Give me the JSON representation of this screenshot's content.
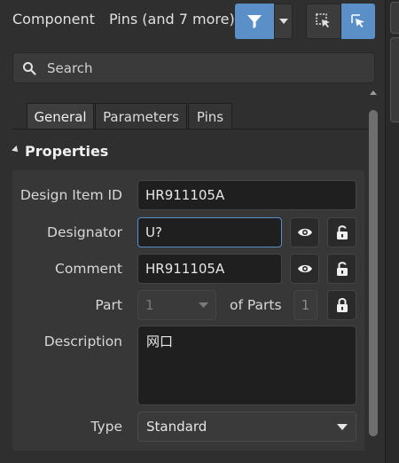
{
  "header": {
    "kind_label": "Component",
    "filter_text": "Pins (and 7 more)"
  },
  "search": {
    "placeholder": "Search"
  },
  "tabs": [
    {
      "label": "General",
      "active": true
    },
    {
      "label": "Parameters",
      "active": false
    },
    {
      "label": "Pins",
      "active": false
    }
  ],
  "section": {
    "title": "Properties"
  },
  "properties": {
    "design_item_id": {
      "label": "Design Item ID",
      "value": "HR911105A"
    },
    "designator": {
      "label": "Designator",
      "value": "U?"
    },
    "comment": {
      "label": "Comment",
      "value": "HR911105A"
    },
    "part": {
      "label": "Part",
      "value": "1",
      "of_parts_label": "of Parts",
      "of_parts_value": "1"
    },
    "description": {
      "label": "Description",
      "value": "网口"
    },
    "type": {
      "label": "Type",
      "value": "Standard"
    }
  },
  "colors": {
    "accent": "#5b8fc7",
    "panel": "#2f2f2f",
    "field": "#1f1f1f"
  }
}
